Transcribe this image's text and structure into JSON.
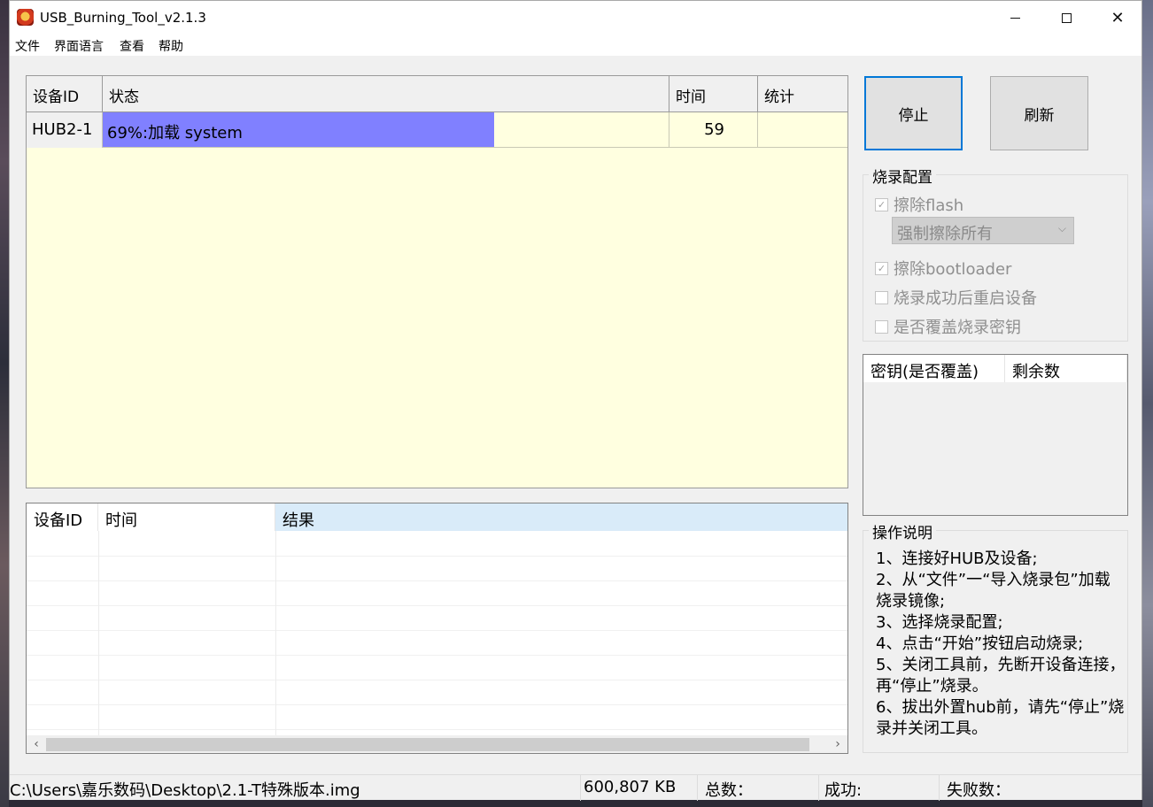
{
  "window": {
    "title": "USB_Burning_Tool_v2.1.3",
    "controls": {
      "minimize": "—",
      "maximize": "☐",
      "close": "✕"
    }
  },
  "menu": [
    "文件",
    "界面语言",
    "查看",
    "帮助"
  ],
  "device_table": {
    "headers": [
      "设备ID",
      "状态",
      "时间",
      "统计"
    ],
    "rows": [
      {
        "device_id": "HUB2-1",
        "status": "69%:加载 system",
        "progress": 0.69,
        "time": "59",
        "stats": ""
      }
    ]
  },
  "buttons": {
    "stop": "停止",
    "refresh": "刷新"
  },
  "burn_config": {
    "title": "烧录配置",
    "erase_flash": {
      "label": "擦除flash",
      "checked": true
    },
    "erase_mode": {
      "selected": "强制擦除所有"
    },
    "erase_bootloader": {
      "label": "擦除bootloader",
      "checked": true
    },
    "reboot_after": {
      "label": "烧录成功后重启设备",
      "checked": false
    },
    "overwrite_key": {
      "label": "是否覆盖烧录密钥",
      "checked": false
    }
  },
  "key_list": {
    "headers": [
      "密钥(是否覆盖)",
      "剩余数"
    ]
  },
  "log_list": {
    "headers": [
      "设备ID",
      "时间",
      "结果"
    ]
  },
  "instructions": {
    "title": "操作说明",
    "text": "1、连接好HUB及设备;\n2、从“文件”一“导入烧录包”加载烧录镜像;\n3、选择烧录配置;\n4、点击“开始”按钮启动烧录;\n5、关闭工具前，先断开设备连接，再“停止”烧录。\n6、拔出外置hub前，请先“停止”烧录并关闭工具。"
  },
  "status_bar": {
    "path": "C:\\Users\\嘉乐数码\\Desktop\\2.1-T特殊版本.img",
    "size": "600,807 KB",
    "total": "总数：",
    "success": "成功:",
    "failed": "失败数："
  },
  "colors": {
    "progress": "#8080ff",
    "device_area": "#ffffe0",
    "focus_border": "#0078d7"
  }
}
